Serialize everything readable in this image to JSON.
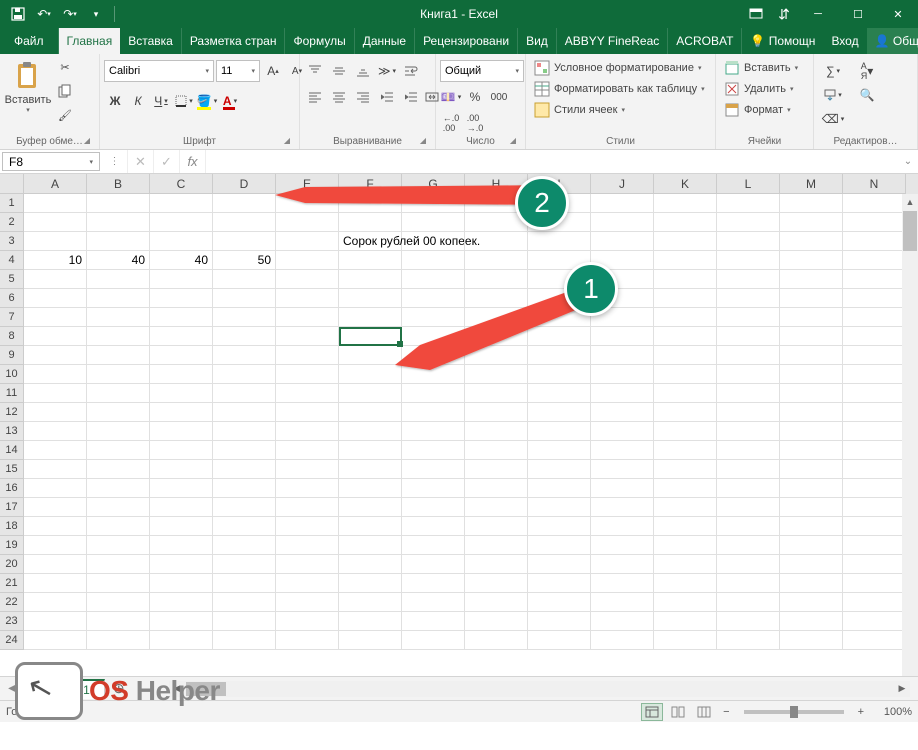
{
  "title": "Книга1 - Excel",
  "qat": {
    "save": "💾",
    "undo": "↶",
    "redo": "↷"
  },
  "tabs": {
    "file": "Файл",
    "home": "Главная",
    "insert": "Вставка",
    "pagelayout": "Разметка стран",
    "formulas": "Формулы",
    "data": "Данные",
    "review": "Рецензировани",
    "view": "Вид",
    "abbyy": "ABBYY FineReac",
    "acrobat": "ACROBAT",
    "tellme": "Помощн",
    "signin": "Вход",
    "share": "Общий доступ"
  },
  "ribbon": {
    "clipboard": {
      "paste": "Вставить",
      "label": "Буфер обме…"
    },
    "font": {
      "name": "Calibri",
      "size": "11",
      "bold": "Ж",
      "italic": "К",
      "underline": "Ч",
      "label": "Шрифт"
    },
    "alignment": {
      "label": "Выравнивание"
    },
    "number": {
      "format": "Общий",
      "label": "Число"
    },
    "styles": {
      "cond": "Условное форматирование",
      "table": "Форматировать как таблицу",
      "cell": "Стили ячеек",
      "label": "Стили"
    },
    "cells": {
      "insert": "Вставить",
      "delete": "Удалить",
      "format": "Формат",
      "label": "Ячейки"
    },
    "editing": {
      "label": "Редактиров…"
    }
  },
  "namebox": "F8",
  "formula": "",
  "columns": [
    "A",
    "B",
    "C",
    "D",
    "E",
    "F",
    "G",
    "H",
    "I",
    "J",
    "K",
    "L",
    "M",
    "N"
  ],
  "rows": [
    "1",
    "2",
    "3",
    "4",
    "5",
    "6",
    "7",
    "8",
    "9",
    "10",
    "11",
    "12",
    "13",
    "14",
    "15",
    "16",
    "17",
    "18",
    "19",
    "20",
    "21",
    "22",
    "23",
    "24"
  ],
  "cellData": {
    "F3": "Сорок рублей  00 копеек.",
    "A4": "10",
    "B4": "40",
    "C4": "40",
    "D4": "50"
  },
  "sheet": {
    "name": "Лист1"
  },
  "status": {
    "ready": "Готово",
    "zoom": "100%"
  },
  "annotations": {
    "one": "1",
    "two": "2"
  },
  "watermark": {
    "os": "OS",
    "helper": "Helper"
  }
}
